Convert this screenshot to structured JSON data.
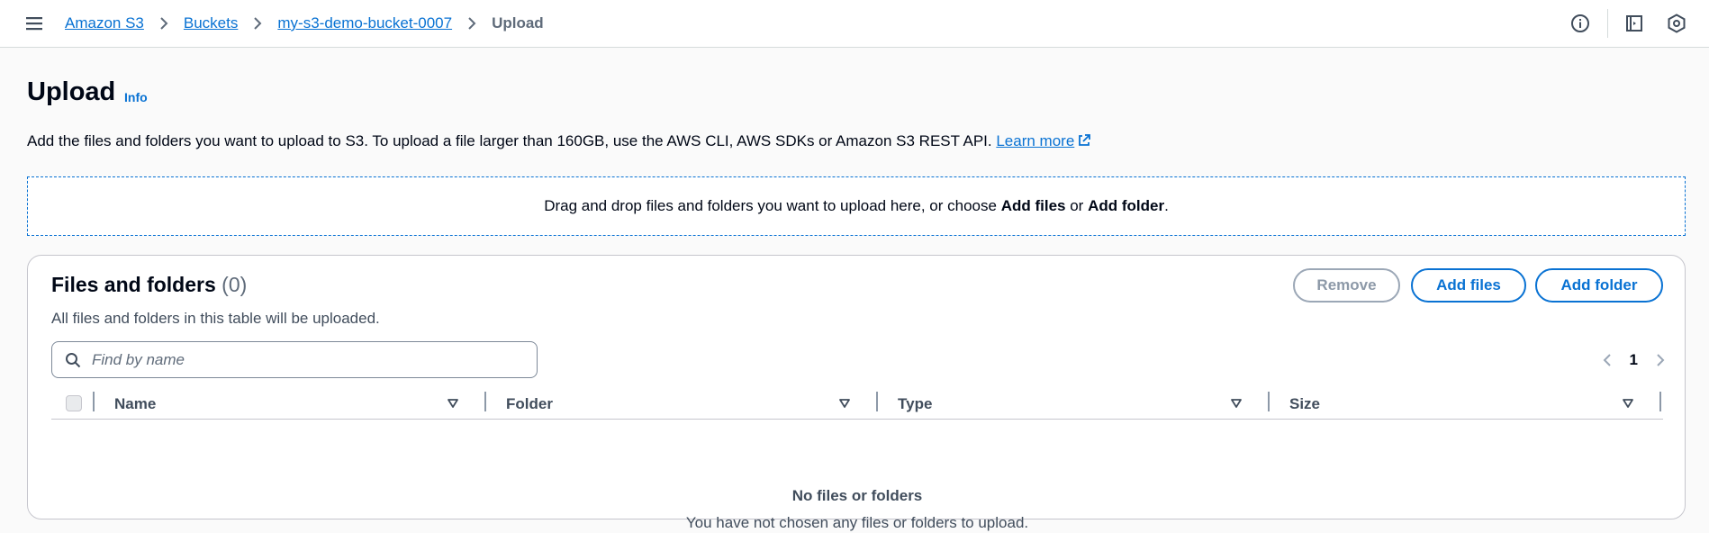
{
  "breadcrumb": {
    "items": [
      "Amazon S3",
      "Buckets",
      "my-s3-demo-bucket-0007"
    ],
    "current": "Upload"
  },
  "page": {
    "title": "Upload",
    "info": "Info",
    "description": "Add the files and folders you want to upload to S3. To upload a file larger than 160GB, use the AWS CLI, AWS SDKs or Amazon S3 REST API.",
    "learn_more": "Learn more"
  },
  "dropzone": {
    "text_before": "Drag and drop files and folders you want to upload here, or choose",
    "add_files": "Add files",
    "or": "or",
    "add_folder": "Add folder",
    "end": "."
  },
  "panel": {
    "title": "Files and folders",
    "count": "(0)",
    "subtitle": "All files and folders in this table will be uploaded.",
    "buttons": {
      "remove": "Remove",
      "add_files": "Add files",
      "add_folder": "Add folder"
    },
    "search_placeholder": "Find by name",
    "page_number": "1",
    "columns": [
      "Name",
      "Folder",
      "Type",
      "Size"
    ],
    "empty_title": "No files or folders",
    "empty_subtitle": "You have not chosen any files or folders to upload."
  },
  "colors": {
    "link": "#0972d3",
    "text": "#000716",
    "muted": "#414d5c"
  },
  "icons": [
    "menu-icon",
    "chevron-right-icon",
    "info-icon",
    "notes-icon",
    "settings-icon",
    "external-link-icon",
    "search-icon",
    "caret-down-icon"
  ]
}
